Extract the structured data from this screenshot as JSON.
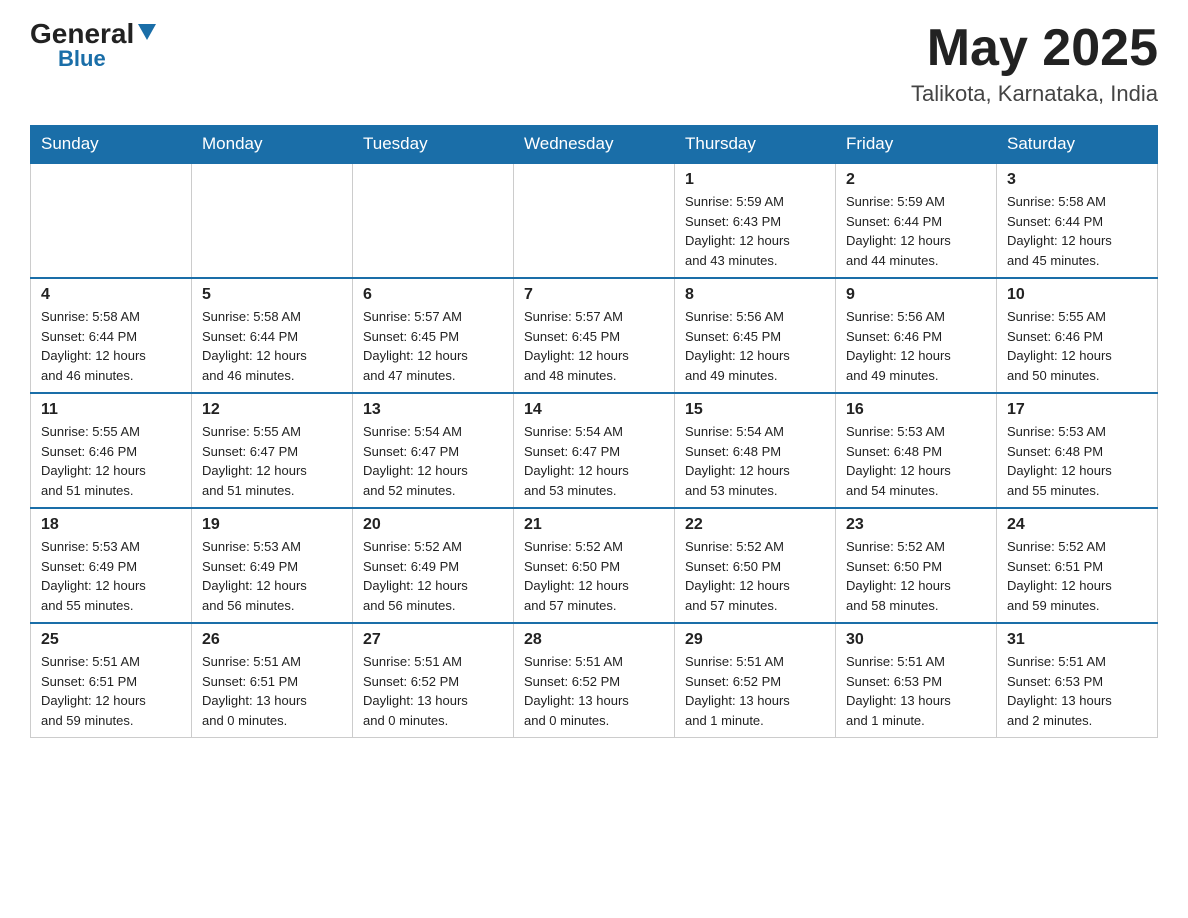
{
  "header": {
    "logo_general": "General",
    "logo_blue": "Blue",
    "month_year": "May 2025",
    "location": "Talikota, Karnataka, India"
  },
  "days_of_week": [
    "Sunday",
    "Monday",
    "Tuesday",
    "Wednesday",
    "Thursday",
    "Friday",
    "Saturday"
  ],
  "weeks": [
    [
      {
        "day": "",
        "info": ""
      },
      {
        "day": "",
        "info": ""
      },
      {
        "day": "",
        "info": ""
      },
      {
        "day": "",
        "info": ""
      },
      {
        "day": "1",
        "info": "Sunrise: 5:59 AM\nSunset: 6:43 PM\nDaylight: 12 hours\nand 43 minutes."
      },
      {
        "day": "2",
        "info": "Sunrise: 5:59 AM\nSunset: 6:44 PM\nDaylight: 12 hours\nand 44 minutes."
      },
      {
        "day": "3",
        "info": "Sunrise: 5:58 AM\nSunset: 6:44 PM\nDaylight: 12 hours\nand 45 minutes."
      }
    ],
    [
      {
        "day": "4",
        "info": "Sunrise: 5:58 AM\nSunset: 6:44 PM\nDaylight: 12 hours\nand 46 minutes."
      },
      {
        "day": "5",
        "info": "Sunrise: 5:58 AM\nSunset: 6:44 PM\nDaylight: 12 hours\nand 46 minutes."
      },
      {
        "day": "6",
        "info": "Sunrise: 5:57 AM\nSunset: 6:45 PM\nDaylight: 12 hours\nand 47 minutes."
      },
      {
        "day": "7",
        "info": "Sunrise: 5:57 AM\nSunset: 6:45 PM\nDaylight: 12 hours\nand 48 minutes."
      },
      {
        "day": "8",
        "info": "Sunrise: 5:56 AM\nSunset: 6:45 PM\nDaylight: 12 hours\nand 49 minutes."
      },
      {
        "day": "9",
        "info": "Sunrise: 5:56 AM\nSunset: 6:46 PM\nDaylight: 12 hours\nand 49 minutes."
      },
      {
        "day": "10",
        "info": "Sunrise: 5:55 AM\nSunset: 6:46 PM\nDaylight: 12 hours\nand 50 minutes."
      }
    ],
    [
      {
        "day": "11",
        "info": "Sunrise: 5:55 AM\nSunset: 6:46 PM\nDaylight: 12 hours\nand 51 minutes."
      },
      {
        "day": "12",
        "info": "Sunrise: 5:55 AM\nSunset: 6:47 PM\nDaylight: 12 hours\nand 51 minutes."
      },
      {
        "day": "13",
        "info": "Sunrise: 5:54 AM\nSunset: 6:47 PM\nDaylight: 12 hours\nand 52 minutes."
      },
      {
        "day": "14",
        "info": "Sunrise: 5:54 AM\nSunset: 6:47 PM\nDaylight: 12 hours\nand 53 minutes."
      },
      {
        "day": "15",
        "info": "Sunrise: 5:54 AM\nSunset: 6:48 PM\nDaylight: 12 hours\nand 53 minutes."
      },
      {
        "day": "16",
        "info": "Sunrise: 5:53 AM\nSunset: 6:48 PM\nDaylight: 12 hours\nand 54 minutes."
      },
      {
        "day": "17",
        "info": "Sunrise: 5:53 AM\nSunset: 6:48 PM\nDaylight: 12 hours\nand 55 minutes."
      }
    ],
    [
      {
        "day": "18",
        "info": "Sunrise: 5:53 AM\nSunset: 6:49 PM\nDaylight: 12 hours\nand 55 minutes."
      },
      {
        "day": "19",
        "info": "Sunrise: 5:53 AM\nSunset: 6:49 PM\nDaylight: 12 hours\nand 56 minutes."
      },
      {
        "day": "20",
        "info": "Sunrise: 5:52 AM\nSunset: 6:49 PM\nDaylight: 12 hours\nand 56 minutes."
      },
      {
        "day": "21",
        "info": "Sunrise: 5:52 AM\nSunset: 6:50 PM\nDaylight: 12 hours\nand 57 minutes."
      },
      {
        "day": "22",
        "info": "Sunrise: 5:52 AM\nSunset: 6:50 PM\nDaylight: 12 hours\nand 57 minutes."
      },
      {
        "day": "23",
        "info": "Sunrise: 5:52 AM\nSunset: 6:50 PM\nDaylight: 12 hours\nand 58 minutes."
      },
      {
        "day": "24",
        "info": "Sunrise: 5:52 AM\nSunset: 6:51 PM\nDaylight: 12 hours\nand 59 minutes."
      }
    ],
    [
      {
        "day": "25",
        "info": "Sunrise: 5:51 AM\nSunset: 6:51 PM\nDaylight: 12 hours\nand 59 minutes."
      },
      {
        "day": "26",
        "info": "Sunrise: 5:51 AM\nSunset: 6:51 PM\nDaylight: 13 hours\nand 0 minutes."
      },
      {
        "day": "27",
        "info": "Sunrise: 5:51 AM\nSunset: 6:52 PM\nDaylight: 13 hours\nand 0 minutes."
      },
      {
        "day": "28",
        "info": "Sunrise: 5:51 AM\nSunset: 6:52 PM\nDaylight: 13 hours\nand 0 minutes."
      },
      {
        "day": "29",
        "info": "Sunrise: 5:51 AM\nSunset: 6:52 PM\nDaylight: 13 hours\nand 1 minute."
      },
      {
        "day": "30",
        "info": "Sunrise: 5:51 AM\nSunset: 6:53 PM\nDaylight: 13 hours\nand 1 minute."
      },
      {
        "day": "31",
        "info": "Sunrise: 5:51 AM\nSunset: 6:53 PM\nDaylight: 13 hours\nand 2 minutes."
      }
    ]
  ]
}
